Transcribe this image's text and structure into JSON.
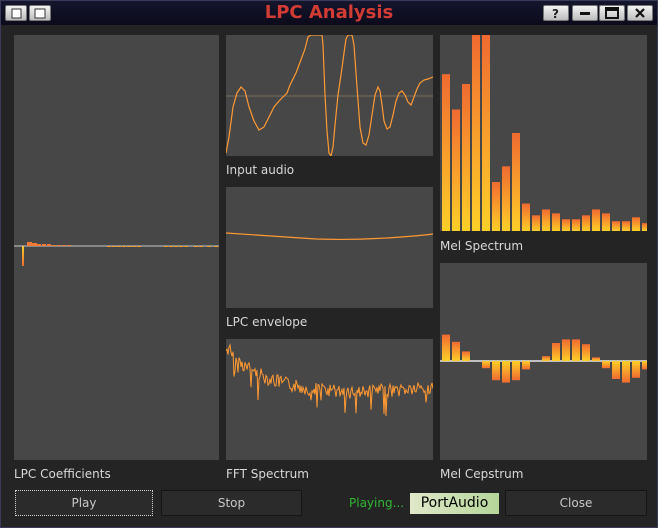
{
  "window": {
    "title": "LPC Analysis"
  },
  "titlebar_buttons": [
    {
      "icon": "help-icon",
      "label": "?"
    },
    {
      "icon": "minimize-icon"
    },
    {
      "icon": "maximize-icon"
    },
    {
      "icon": "close-icon",
      "label": "x"
    }
  ],
  "panels": {
    "lpc_coefficients": {
      "label": "LPC Coefficients"
    },
    "input_audio": {
      "label": "Input audio"
    },
    "lpc_envelope": {
      "label": "LPC envelope"
    },
    "fft_spectrum": {
      "label": "FFT Spectrum"
    },
    "mel_spectrum": {
      "label": "Mel Spectrum",
      "values": [
        0.8,
        0.62,
        0.75,
        1.0,
        1.0,
        0.25,
        0.33,
        0.5,
        0.14,
        0.08,
        0.11,
        0.09,
        0.06,
        0.06,
        0.08,
        0.11,
        0.09,
        0.05,
        0.05,
        0.07,
        0.04
      ]
    },
    "mel_cepstrum": {
      "label": "Mel Cepstrum",
      "values": [
        0.22,
        0.16,
        0.08,
        0.0,
        -0.06,
        -0.16,
        -0.18,
        -0.16,
        -0.07,
        0.0,
        0.04,
        0.15,
        0.18,
        0.18,
        0.14,
        0.03,
        -0.06,
        -0.15,
        -0.18,
        -0.14,
        -0.07
      ]
    }
  },
  "buttons": {
    "play": "Play",
    "stop": "Stop",
    "close": "Close"
  },
  "status": "Playing...",
  "audio_backend": "PortAudio",
  "colors": {
    "accent": "#ff9933",
    "bar_top": "#f06a30",
    "bar_bottom": "#ffd028",
    "status": "#2fb830",
    "title": "#d23c34"
  }
}
